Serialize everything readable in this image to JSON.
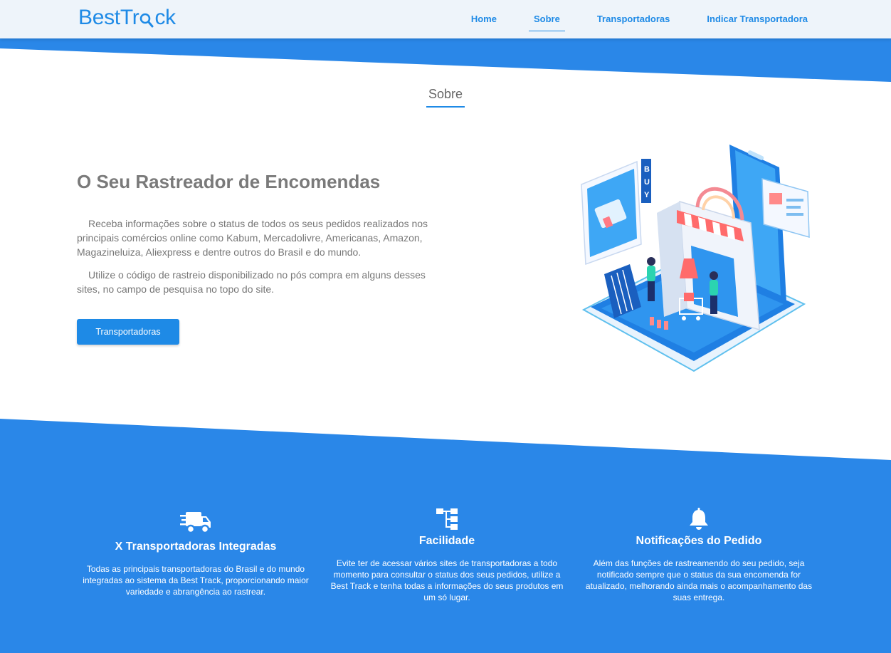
{
  "brand": {
    "name_before": "BestTr",
    "name_after": "ck"
  },
  "nav": {
    "items": [
      {
        "label": "Home",
        "active": false
      },
      {
        "label": "Sobre",
        "active": true
      },
      {
        "label": "Transportadoras",
        "active": false
      },
      {
        "label": "Indicar Transportadora",
        "active": false
      }
    ]
  },
  "section": {
    "title": "Sobre"
  },
  "hero": {
    "heading": "O Seu Rastreador de Encomendas",
    "paragraphs": [
      "Receba informações sobre o status de todos os seus pedidos realizados nos principais comércios online como Kabum, Mercadolivre, Americanas, Amazon, Magazineluiza, Aliexpress e dentre outros do Brasil e do mundo.",
      "Utilize o código de rastreio disponibilizado no pós compra em alguns desses sites, no campo de pesquisa no topo do site."
    ],
    "button_label": "Transportadoras",
    "illustration_icon": "isometric-shop-illustration"
  },
  "features": [
    {
      "icon": "truck-icon",
      "title": "X Transportadoras Integradas",
      "text": "Todas as principais transportadoras do Brasil e do mundo integradas ao sistema da Best Track, proporcionando maior variedade e abrangência ao rastrear."
    },
    {
      "icon": "sitemap-icon",
      "title": "Facilidade",
      "text": "Evite ter de acessar vários sites de transportadoras a todo momento para consultar o status dos seus pedidos, utilize a Best Track e tenha todas a informações do seus produtos em um só lugar."
    },
    {
      "icon": "bell-icon",
      "title": "Notificações do Pedido",
      "text": "Além das funções de rastreamendo do seu pedido, seja notificado sempre que o status da sua encomenda for atualizado, melhorando ainda mais o acompanhamento das suas entrega."
    }
  ],
  "colors": {
    "primary": "#2a87e8",
    "nav_bg": "#eef4fa",
    "text_gray": "#777777"
  }
}
